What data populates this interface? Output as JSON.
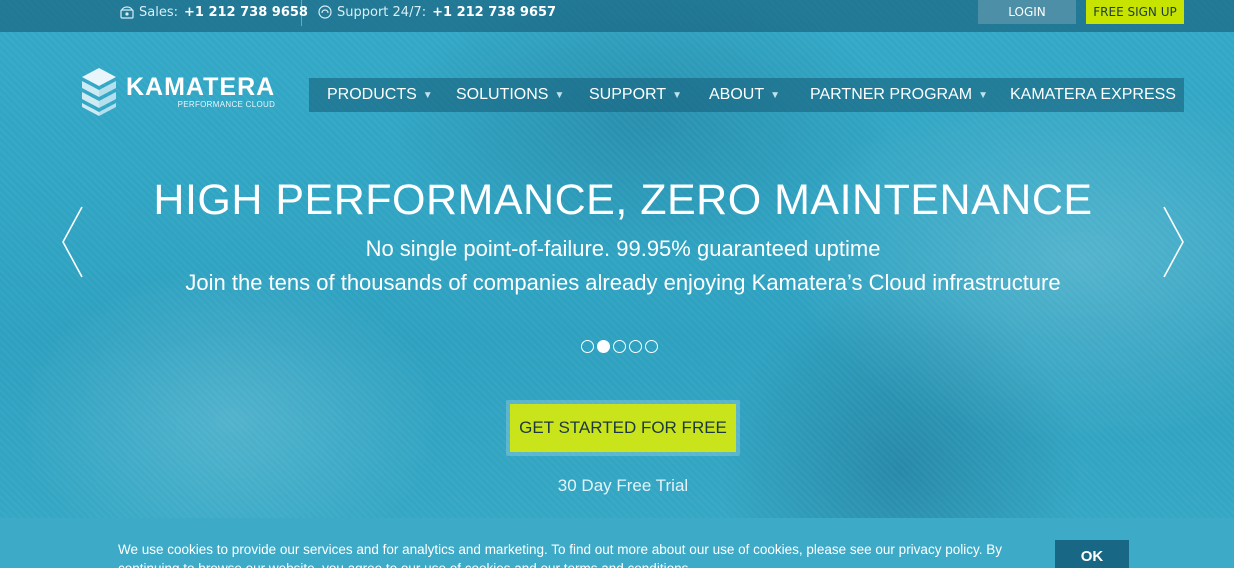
{
  "topbar": {
    "sales_label": "Sales:",
    "sales_phone": "+1 212 738 9658",
    "support_label": "Support 24/7:",
    "support_phone": "+1 212 738 9657",
    "login_label": "LOGIN",
    "signup_label": "FREE SIGN UP",
    "sales_icon": "phone-icon",
    "support_icon": "headset-icon"
  },
  "logo": {
    "name": "KAMATERA",
    "tagline": "PERFORMANCE CLOUD"
  },
  "nav": {
    "items": [
      {
        "label": "PRODUCTS",
        "has_dropdown": true
      },
      {
        "label": "SOLUTIONS",
        "has_dropdown": true
      },
      {
        "label": "SUPPORT",
        "has_dropdown": true
      },
      {
        "label": "ABOUT",
        "has_dropdown": true
      },
      {
        "label": "PARTNER PROGRAM",
        "has_dropdown": true
      },
      {
        "label": "KAMATERA EXPRESS",
        "has_dropdown": false
      }
    ],
    "caret": "▼"
  },
  "hero": {
    "headline": "HIGH PERFORMANCE, ZERO MAINTENANCE",
    "subline1": "No single point-of-failure. 99.95% guaranteed uptime",
    "subline2": "Join the tens of thousands of companies already enjoying Kamatera’s Cloud infrastructure",
    "slides_total": 5,
    "active_slide": 2,
    "cta_label": "GET STARTED FOR FREE",
    "trial_text": "30 Day Free Trial"
  },
  "cookie": {
    "text": "We use cookies to provide our services and for analytics and marketing. To find out more about our use of cookies, please see our privacy policy. By continuing to browse our website, you agree to our use of cookies and our terms and conditions.",
    "ok_label": "OK"
  },
  "colors": {
    "hero_bg": "#2fa3c2",
    "accent_green": "#c9e41a",
    "login_bg": "#4d8fa6",
    "ok_bg": "#176785"
  }
}
